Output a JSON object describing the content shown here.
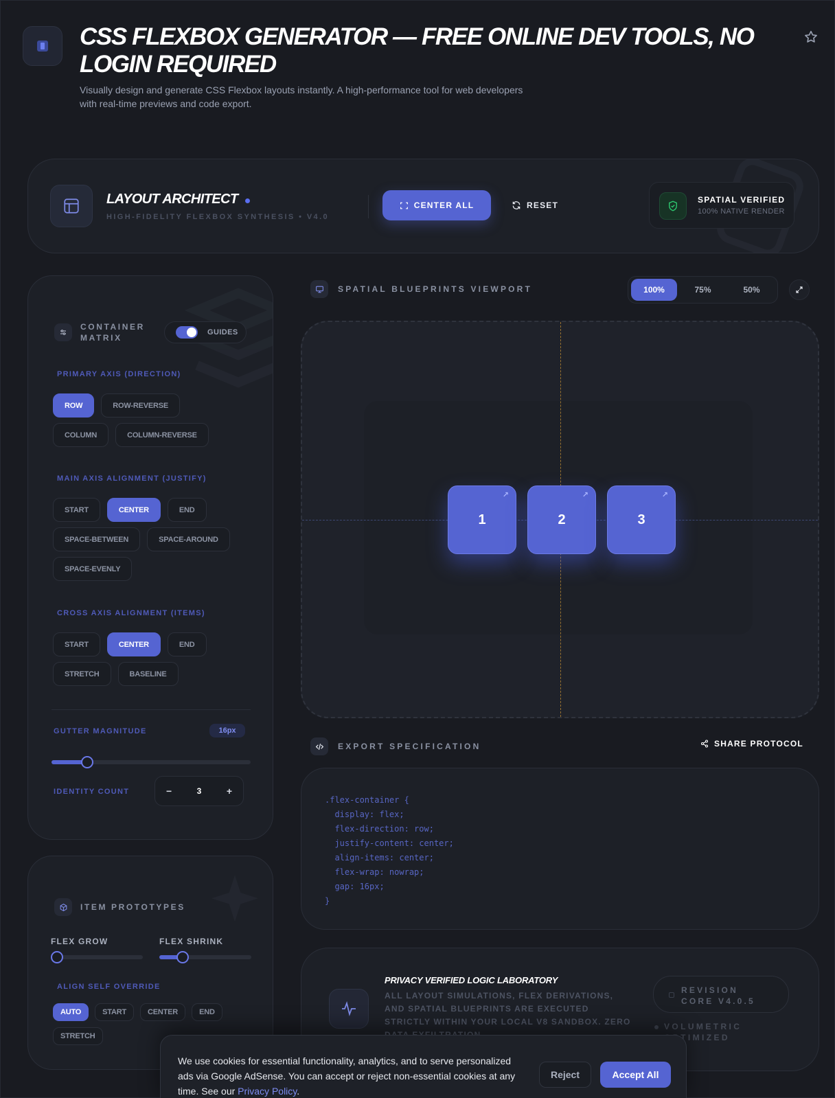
{
  "header": {
    "title": "CSS Flexbox Generator — Free Online Dev Tools, No Login Required",
    "subtitle": "Visually design and generate CSS Flexbox layouts instantly. A high-performance tool for web developers with real-time previews and code export."
  },
  "architect": {
    "title": "Layout Architect",
    "tagline": "High-Fidelity Flexbox Synthesis • V4.0",
    "center_label": "Center All",
    "reset_label": "Reset",
    "verified_title": "SPATIAL VERIFIED",
    "verified_sub": "100% NATIVE RENDER"
  },
  "container": {
    "title": "Container Matrix",
    "guides_label": "GUIDES",
    "guides_on": true,
    "direction_label": "Primary Axis (Direction)",
    "direction_options": [
      "ROW",
      "ROW-REVERSE",
      "COLUMN",
      "COLUMN-REVERSE"
    ],
    "direction_selected": "ROW",
    "justify_label": "Main Axis Alignment (Justify)",
    "justify_options": [
      "START",
      "CENTER",
      "END",
      "SPACE-BETWEEN",
      "SPACE-AROUND",
      "SPACE-EVENLY"
    ],
    "justify_selected": "CENTER",
    "items_label": "Cross Axis Alignment (Items)",
    "items_options": [
      "START",
      "CENTER",
      "END",
      "STRETCH",
      "BASELINE"
    ],
    "items_selected": "CENTER",
    "gutter_label": "Gutter Magnitude",
    "gutter_value": "16px",
    "gutter_fraction": 0.18,
    "count_label": "Identity Count",
    "count_value": "3",
    "minus": "−",
    "plus": "+"
  },
  "prototypes": {
    "title": "Item Prototypes",
    "grow_label": "FLEX GROW",
    "grow_fraction": 0.0,
    "shrink_label": "FLEX SHRINK",
    "shrink_fraction": 0.25,
    "align_self_label": "Align Self Override",
    "align_self_options": [
      "AUTO",
      "START",
      "CENTER",
      "END",
      "STRETCH"
    ],
    "align_self_selected": "AUTO"
  },
  "viewport": {
    "title": "SPATIAL BLUEPRINTS VIEWPORT",
    "zoom_options": [
      "100%",
      "75%",
      "50%"
    ],
    "zoom_selected": "100%",
    "items": [
      "1",
      "2",
      "3"
    ]
  },
  "export": {
    "title": "EXPORT SPECIFICATION",
    "share_label": "SHARE PROTOCOL",
    "code_lines": [
      ".flex-container {",
      "  display: flex;",
      "  flex-direction: row;",
      "  justify-content: center;",
      "  align-items: center;",
      "  flex-wrap: nowrap;",
      "  gap: 16px;",
      "}"
    ]
  },
  "privacy": {
    "title": "Privacy Verified Logic Laboratory",
    "text": "All layout simulations, flex derivations, and spatial blueprints are executed strictly within your local V8 sandbox. Zero data exfiltration.",
    "revision": "Revision Core V4.0.5",
    "volumetric": "Volumetric Optimized"
  },
  "cookie": {
    "text": "We use cookies for essential functionality, analytics, and to serve personalized ads via Google AdSense. You can accept or reject non-essential cookies at any time. See our ",
    "link": "Privacy Policy",
    "after": ".",
    "reject_label": "Reject",
    "accept_label": "Accept All"
  },
  "colors": {
    "accent": "#5564d2",
    "background": "#191b21",
    "panel": "#1d2027",
    "guide_vertical": "#9a7330",
    "verified_green": "#2ecc71"
  },
  "icons": [
    "chip-icon",
    "star-icon",
    "layout-icon",
    "focus-icon",
    "refresh-icon",
    "shield-icon",
    "sliders-icon",
    "cube-icon",
    "monitor-icon",
    "expand-icon",
    "code-icon",
    "share-icon",
    "pulse-icon"
  ]
}
